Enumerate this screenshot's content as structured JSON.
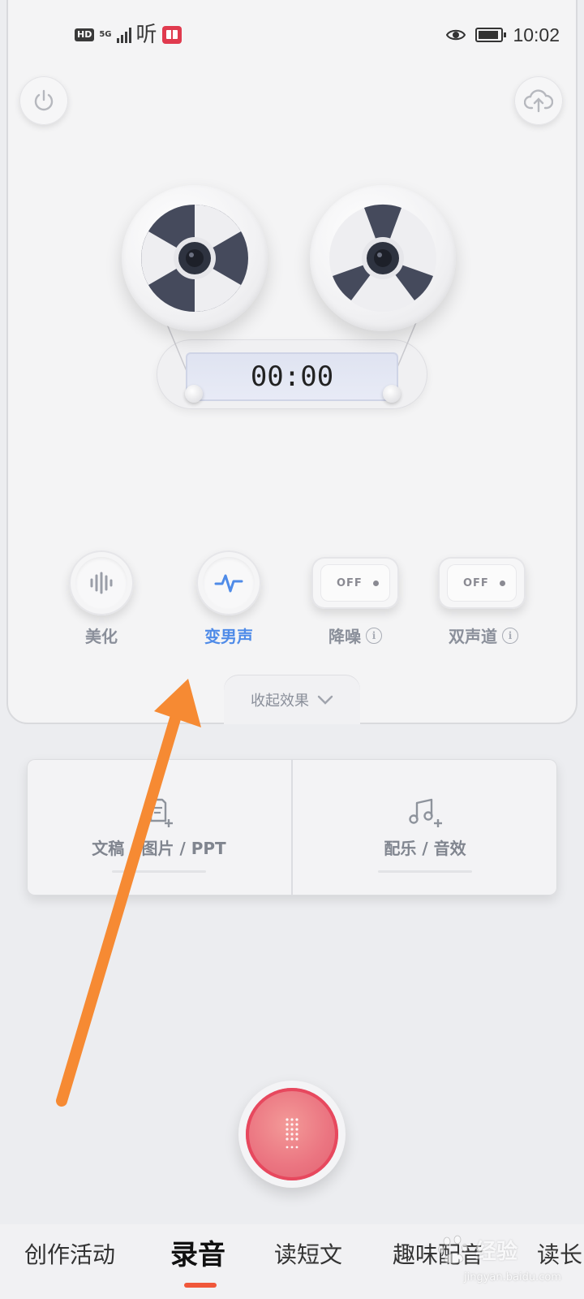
{
  "status_bar": {
    "hd": "HD",
    "network": "5G",
    "app_logo": "听",
    "time": "10:02"
  },
  "player": {
    "timer": "00:00"
  },
  "effects": [
    {
      "label": "美化",
      "type": "circle",
      "icon": "waveform-icon",
      "active": false
    },
    {
      "label": "变男声",
      "type": "circle",
      "icon": "pulse-icon",
      "active": true
    },
    {
      "label": "降噪",
      "type": "switch",
      "state": "OFF",
      "info": "i"
    },
    {
      "label": "双声道",
      "type": "switch",
      "state": "OFF",
      "info": "i"
    }
  ],
  "collapse_label": "收起效果",
  "tools": [
    {
      "label": "文稿 / 图片 / PPT",
      "icon": "document-add-icon"
    },
    {
      "label": "配乐 / 音效",
      "icon": "music-add-icon"
    }
  ],
  "tabs": [
    {
      "label": "创作活动",
      "active": false
    },
    {
      "label": "录音",
      "active": true
    },
    {
      "label": "读短文",
      "active": false
    },
    {
      "label": "趣味配音",
      "active": false
    },
    {
      "label": "读长",
      "active": false
    }
  ],
  "watermark": {
    "text": "经验",
    "sub": "jingyan.baidu.com"
  },
  "colors": {
    "accent_blue": "#4f8be8",
    "record_red": "#e7485e",
    "tab_underline": "#f0573a",
    "annotation_arrow": "#f68a33"
  }
}
